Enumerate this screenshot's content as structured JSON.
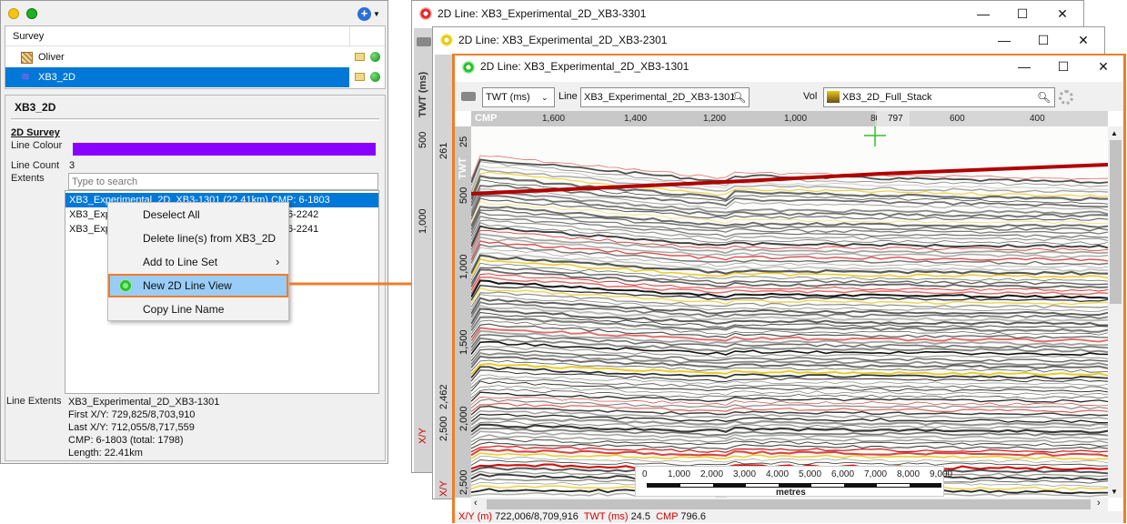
{
  "survey_panel": {
    "header": "Survey",
    "surveys": [
      {
        "name": "Oliver",
        "selected": false
      },
      {
        "name": "XB3_2D",
        "selected": true
      }
    ]
  },
  "details": {
    "title": "XB3_2D",
    "section": "2D Survey",
    "line_colour_label": "Line Colour",
    "line_colour": "#8a00ff",
    "line_count_label": "Line Count",
    "line_count": "3",
    "extents_label": "Extents",
    "search_placeholder": "Type to search",
    "lines": [
      {
        "left": "XB3_Experimental_2D_XB3-1301 (22.41km) CMP: 6-1803",
        "right": "",
        "selected": true
      },
      {
        "left": "XB3_Exp",
        "right": "6-2242",
        "selected": false
      },
      {
        "left": "XB3_Exp",
        "right": "6-2241",
        "selected": false
      }
    ],
    "line_extents_label": "Line Extents",
    "line_extents": [
      "XB3_Experimental_2D_XB3-1301",
      "First X/Y: 729,825/8,703,910",
      "Last X/Y: 712,055/8,717,559",
      "CMP: 6-1803 (total: 1798)",
      "Length: 22.41km"
    ]
  },
  "context_menu": {
    "items": [
      "Deselect All",
      "Delete line(s) from XB3_2D",
      "Add to Line Set",
      "New 2D Line View",
      "Copy Line Name"
    ],
    "submenu_arrow": "›",
    "highlighted_index": 3
  },
  "windows": [
    {
      "title": "2D Line: XB3_Experimental_2D_XB3-3301",
      "icon_color": "#e02a2a"
    },
    {
      "title": "2D Line: XB3_Experimental_2D_XB3-2301",
      "icon_color": "#e8c817"
    },
    {
      "title": "2D Line: XB3_Experimental_2D_XB3-1301",
      "icon_color": "#2fbf2f"
    }
  ],
  "window_controls": {
    "minimize": "—",
    "maximize": "☐",
    "close": "✕"
  },
  "toolbar": {
    "domain_select": "TWT (ms)",
    "line_label": "Line",
    "line_value": "XB3_Experimental_2D_XB3-1301",
    "vol_label": "Vol",
    "vol_value": "XB3_2D_Full_Stack"
  },
  "seismic": {
    "cmp_label": "CMP",
    "cmp_ticks": [
      "1,600",
      "1,400",
      "1,200",
      "1,000",
      "800",
      "600",
      "400"
    ],
    "cursor_cmp": "797",
    "twt_label": "TWT",
    "twt_ticks": [
      "25",
      "500",
      "1,000",
      "1,500",
      "2,000",
      "2,500"
    ],
    "scale_ticks": [
      "0",
      "1,000",
      "2,000",
      "3,000",
      "4,000",
      "5,000",
      "6,000",
      "7,000",
      "8,000",
      "9,000"
    ],
    "scale_unit": "metres"
  },
  "back_window_axis": {
    "label": "TWT (ms)",
    "ticks": [
      "261",
      "500",
      "1,000",
      "1,500",
      "2,000",
      "2,462",
      "2,500"
    ],
    "status_fragments": [
      "X/Y",
      "X/Y"
    ]
  },
  "status": {
    "xy_label": "X/Y (m)",
    "xy_value": "722,006/8,709,916",
    "twt_label": "TWT (ms)",
    "twt_value": "24.5",
    "cmp_label": "CMP",
    "cmp_value": "796.6"
  },
  "colors": {
    "highlight": "#ef7d2a",
    "selection": "#0078d7",
    "menu_hover": "#99cdf7"
  }
}
